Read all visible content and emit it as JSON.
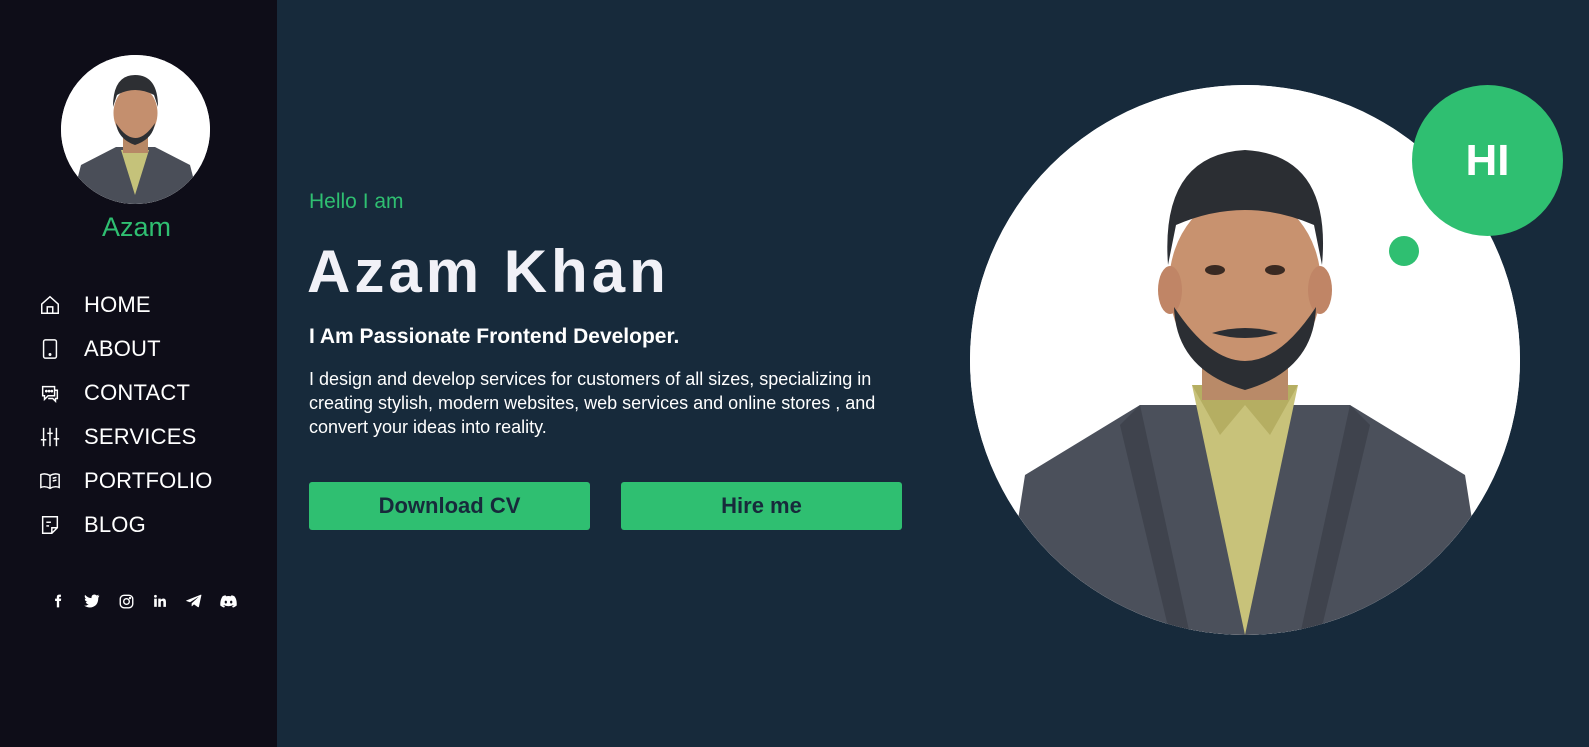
{
  "sidebar": {
    "brand_name": "Azam",
    "nav": [
      {
        "label": "HOME",
        "icon": "home-icon"
      },
      {
        "label": "ABOUT",
        "icon": "tablet-icon"
      },
      {
        "label": "CONTACT",
        "icon": "chat-icon"
      },
      {
        "label": "SERVICES",
        "icon": "sliders-icon"
      },
      {
        "label": "PORTFOLIO",
        "icon": "book-icon"
      },
      {
        "label": "BLOG",
        "icon": "document-icon"
      }
    ],
    "social": [
      "facebook-icon",
      "twitter-icon",
      "instagram-icon",
      "linkedin-icon",
      "telegram-icon",
      "discord-icon"
    ]
  },
  "hero": {
    "greeting": "Hello I am",
    "name": "Azam Khan",
    "tagline": "I Am Passionate Frontend Developer.",
    "description": "I design and develop services for customers of all sizes, specializing in creating stylish, modern websites, web services and online stores , and convert your ideas into reality.",
    "download_cv_label": "Download CV",
    "hire_me_label": "Hire me",
    "badge_text": "HI"
  },
  "colors": {
    "accent": "#2fbf71",
    "sidebar_bg": "#0e0d18",
    "main_bg": "#172a3b"
  }
}
